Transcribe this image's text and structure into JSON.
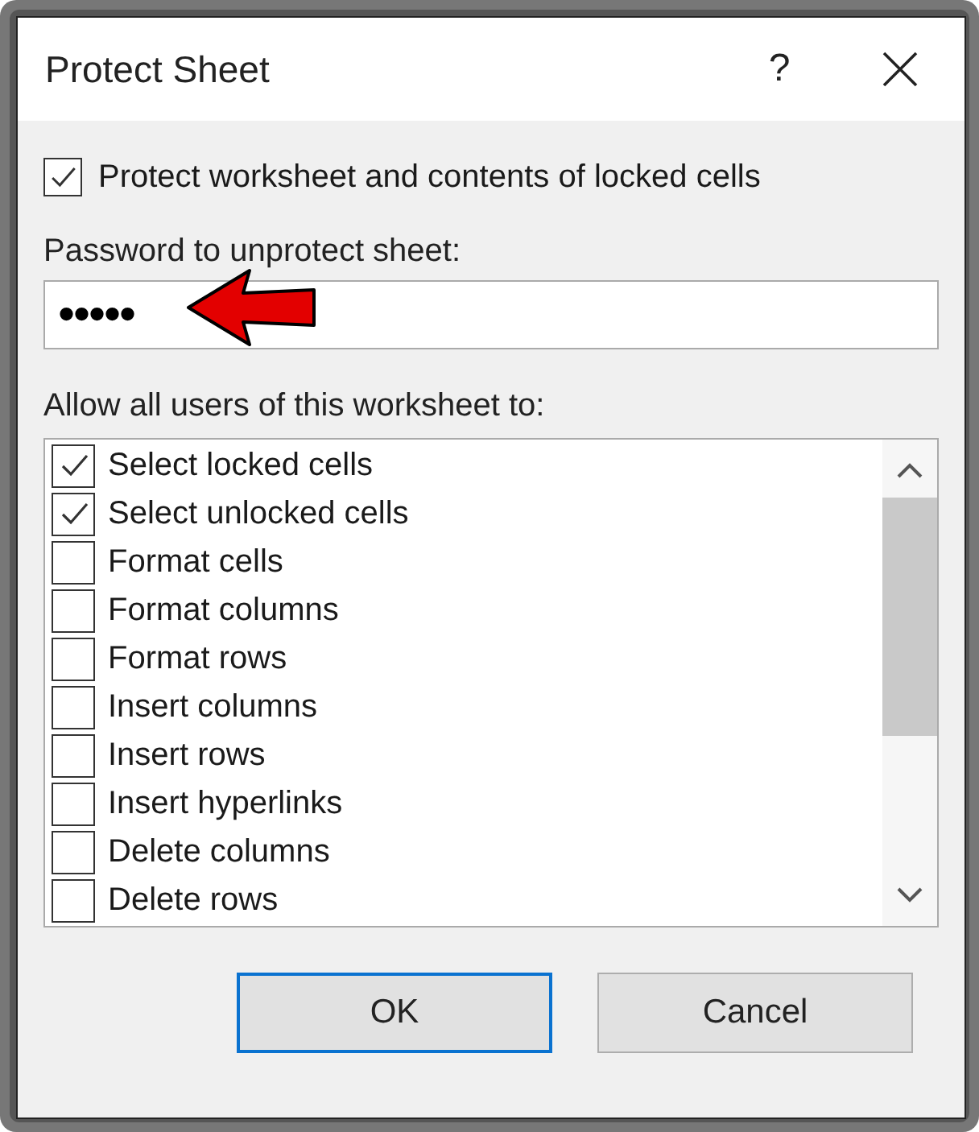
{
  "window": {
    "title": "Protect Sheet",
    "help": "?"
  },
  "protect_checkbox": {
    "label": "Protect worksheet and contents of locked cells",
    "checked": true
  },
  "password": {
    "label": "Password to unprotect sheet:",
    "value": "•••••"
  },
  "permissions": {
    "label": "Allow all users of this worksheet to:",
    "items": [
      {
        "label": "Select locked cells",
        "checked": true
      },
      {
        "label": "Select unlocked cells",
        "checked": true
      },
      {
        "label": "Format cells",
        "checked": false
      },
      {
        "label": "Format columns",
        "checked": false
      },
      {
        "label": "Format rows",
        "checked": false
      },
      {
        "label": "Insert columns",
        "checked": false
      },
      {
        "label": "Insert rows",
        "checked": false
      },
      {
        "label": "Insert hyperlinks",
        "checked": false
      },
      {
        "label": "Delete columns",
        "checked": false
      },
      {
        "label": "Delete rows",
        "checked": false
      }
    ]
  },
  "buttons": [
    {
      "label": "OK",
      "default": true
    },
    {
      "label": "Cancel",
      "default": false
    }
  ]
}
